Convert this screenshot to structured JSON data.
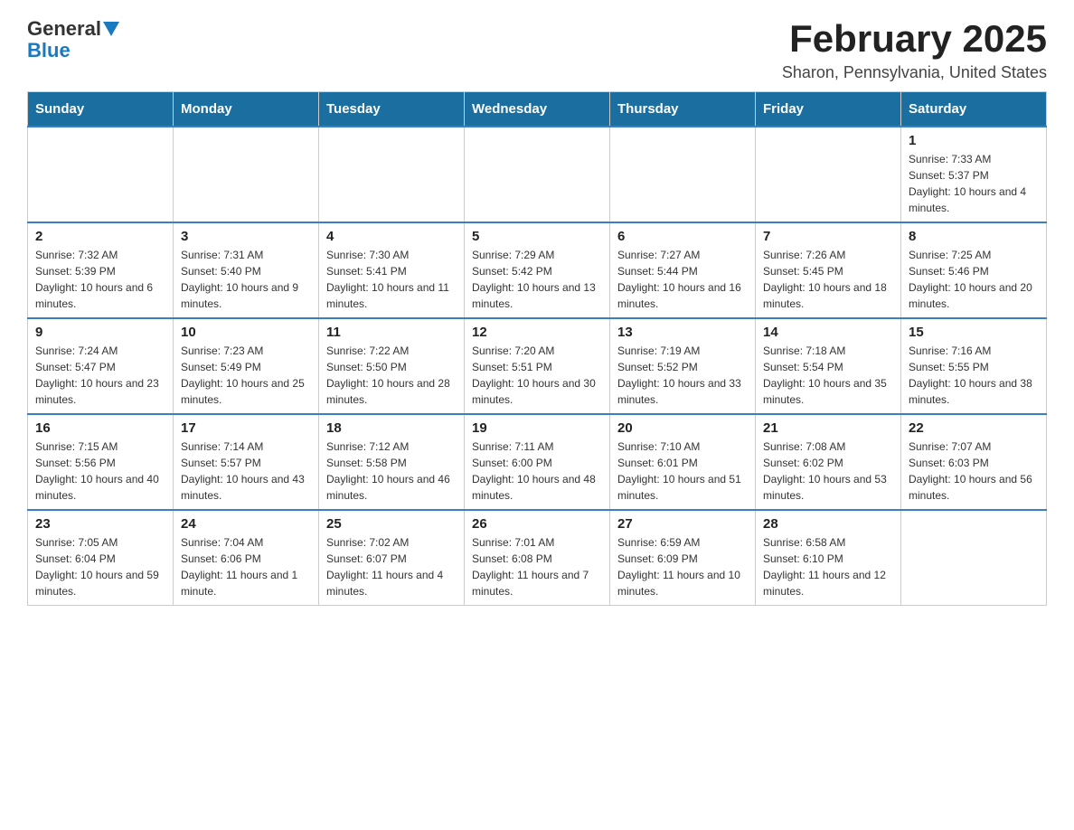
{
  "logo": {
    "general": "General",
    "blue": "Blue",
    "arrow": "▲"
  },
  "title": "February 2025",
  "location": "Sharon, Pennsylvania, United States",
  "days_of_week": [
    "Sunday",
    "Monday",
    "Tuesday",
    "Wednesday",
    "Thursday",
    "Friday",
    "Saturday"
  ],
  "weeks": [
    [
      {
        "day": "",
        "info": ""
      },
      {
        "day": "",
        "info": ""
      },
      {
        "day": "",
        "info": ""
      },
      {
        "day": "",
        "info": ""
      },
      {
        "day": "",
        "info": ""
      },
      {
        "day": "",
        "info": ""
      },
      {
        "day": "1",
        "info": "Sunrise: 7:33 AM\nSunset: 5:37 PM\nDaylight: 10 hours and 4 minutes."
      }
    ],
    [
      {
        "day": "2",
        "info": "Sunrise: 7:32 AM\nSunset: 5:39 PM\nDaylight: 10 hours and 6 minutes."
      },
      {
        "day": "3",
        "info": "Sunrise: 7:31 AM\nSunset: 5:40 PM\nDaylight: 10 hours and 9 minutes."
      },
      {
        "day": "4",
        "info": "Sunrise: 7:30 AM\nSunset: 5:41 PM\nDaylight: 10 hours and 11 minutes."
      },
      {
        "day": "5",
        "info": "Sunrise: 7:29 AM\nSunset: 5:42 PM\nDaylight: 10 hours and 13 minutes."
      },
      {
        "day": "6",
        "info": "Sunrise: 7:27 AM\nSunset: 5:44 PM\nDaylight: 10 hours and 16 minutes."
      },
      {
        "day": "7",
        "info": "Sunrise: 7:26 AM\nSunset: 5:45 PM\nDaylight: 10 hours and 18 minutes."
      },
      {
        "day": "8",
        "info": "Sunrise: 7:25 AM\nSunset: 5:46 PM\nDaylight: 10 hours and 20 minutes."
      }
    ],
    [
      {
        "day": "9",
        "info": "Sunrise: 7:24 AM\nSunset: 5:47 PM\nDaylight: 10 hours and 23 minutes."
      },
      {
        "day": "10",
        "info": "Sunrise: 7:23 AM\nSunset: 5:49 PM\nDaylight: 10 hours and 25 minutes."
      },
      {
        "day": "11",
        "info": "Sunrise: 7:22 AM\nSunset: 5:50 PM\nDaylight: 10 hours and 28 minutes."
      },
      {
        "day": "12",
        "info": "Sunrise: 7:20 AM\nSunset: 5:51 PM\nDaylight: 10 hours and 30 minutes."
      },
      {
        "day": "13",
        "info": "Sunrise: 7:19 AM\nSunset: 5:52 PM\nDaylight: 10 hours and 33 minutes."
      },
      {
        "day": "14",
        "info": "Sunrise: 7:18 AM\nSunset: 5:54 PM\nDaylight: 10 hours and 35 minutes."
      },
      {
        "day": "15",
        "info": "Sunrise: 7:16 AM\nSunset: 5:55 PM\nDaylight: 10 hours and 38 minutes."
      }
    ],
    [
      {
        "day": "16",
        "info": "Sunrise: 7:15 AM\nSunset: 5:56 PM\nDaylight: 10 hours and 40 minutes."
      },
      {
        "day": "17",
        "info": "Sunrise: 7:14 AM\nSunset: 5:57 PM\nDaylight: 10 hours and 43 minutes."
      },
      {
        "day": "18",
        "info": "Sunrise: 7:12 AM\nSunset: 5:58 PM\nDaylight: 10 hours and 46 minutes."
      },
      {
        "day": "19",
        "info": "Sunrise: 7:11 AM\nSunset: 6:00 PM\nDaylight: 10 hours and 48 minutes."
      },
      {
        "day": "20",
        "info": "Sunrise: 7:10 AM\nSunset: 6:01 PM\nDaylight: 10 hours and 51 minutes."
      },
      {
        "day": "21",
        "info": "Sunrise: 7:08 AM\nSunset: 6:02 PM\nDaylight: 10 hours and 53 minutes."
      },
      {
        "day": "22",
        "info": "Sunrise: 7:07 AM\nSunset: 6:03 PM\nDaylight: 10 hours and 56 minutes."
      }
    ],
    [
      {
        "day": "23",
        "info": "Sunrise: 7:05 AM\nSunset: 6:04 PM\nDaylight: 10 hours and 59 minutes."
      },
      {
        "day": "24",
        "info": "Sunrise: 7:04 AM\nSunset: 6:06 PM\nDaylight: 11 hours and 1 minute."
      },
      {
        "day": "25",
        "info": "Sunrise: 7:02 AM\nSunset: 6:07 PM\nDaylight: 11 hours and 4 minutes."
      },
      {
        "day": "26",
        "info": "Sunrise: 7:01 AM\nSunset: 6:08 PM\nDaylight: 11 hours and 7 minutes."
      },
      {
        "day": "27",
        "info": "Sunrise: 6:59 AM\nSunset: 6:09 PM\nDaylight: 11 hours and 10 minutes."
      },
      {
        "day": "28",
        "info": "Sunrise: 6:58 AM\nSunset: 6:10 PM\nDaylight: 11 hours and 12 minutes."
      },
      {
        "day": "",
        "info": ""
      }
    ]
  ]
}
